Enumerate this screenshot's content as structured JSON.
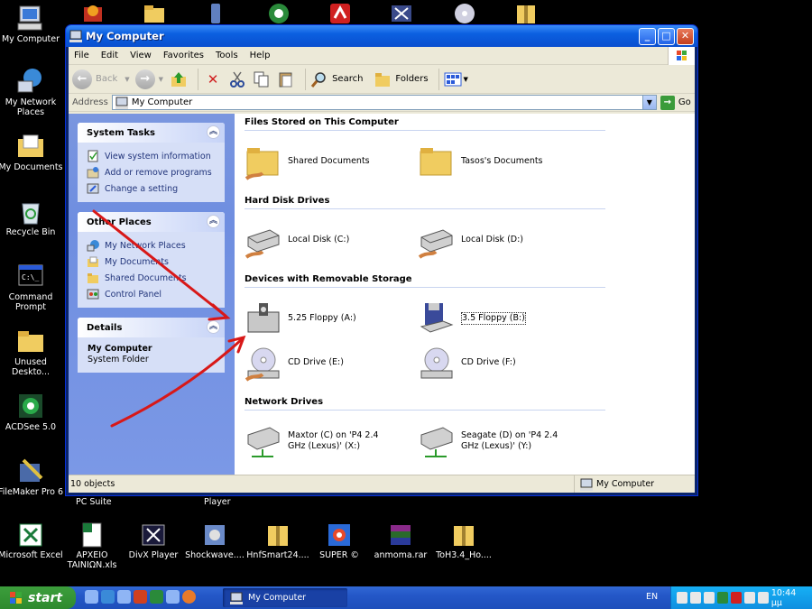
{
  "desktop_icons_left": [
    {
      "label": "My Computer",
      "icon": "my-computer-icon"
    },
    {
      "label": "My Network Places",
      "icon": "network-places-icon"
    },
    {
      "label": "My Documents",
      "icon": "my-documents-icon"
    },
    {
      "label": "Recycle Bin",
      "icon": "recycle-bin-icon"
    },
    {
      "label": "Command Prompt",
      "icon": "command-prompt-icon"
    },
    {
      "label": "Unused Deskto...",
      "icon": "folder-icon"
    },
    {
      "label": "ACDSee 5.0",
      "icon": "acdsee-icon"
    },
    {
      "label": "FileMaker Pro 6",
      "icon": "filemaker-icon"
    }
  ],
  "desktop_icons_bottom": [
    {
      "label": "Microsoft Excel",
      "icon": "excel-icon"
    },
    {
      "label": "APXEIO TAINIΩN.xls",
      "icon": "excel-file-icon"
    },
    {
      "label": "DivX Player",
      "icon": "divx-icon"
    },
    {
      "label": "Shockwave....",
      "icon": "shockwave-icon"
    },
    {
      "label": "HnfSmart24....",
      "icon": "zip-folder-icon"
    },
    {
      "label": "SUPER ©",
      "icon": "super-icon"
    },
    {
      "label": "anmoma.rar",
      "icon": "rar-icon"
    },
    {
      "label": "ToH3.4_Ho....",
      "icon": "zip-folder-icon"
    }
  ],
  "partial_labels": {
    "pc_suite": "PC Suite",
    "player": "Player"
  },
  "window": {
    "title": "My Computer",
    "menu": [
      "File",
      "Edit",
      "View",
      "Favorites",
      "Tools",
      "Help"
    ],
    "toolbar": {
      "back": "Back",
      "search": "Search",
      "folders": "Folders"
    },
    "address_label": "Address",
    "address_value": "My Computer",
    "go_label": "Go"
  },
  "left_pane": {
    "system_tasks": {
      "title": "System Tasks",
      "items": [
        "View system information",
        "Add or remove programs",
        "Change a setting"
      ]
    },
    "other_places": {
      "title": "Other Places",
      "items": [
        "My Network Places",
        "My Documents",
        "Shared Documents",
        "Control Panel"
      ]
    },
    "details": {
      "title": "Details",
      "name": "My Computer",
      "type": "System Folder"
    }
  },
  "sections": {
    "files": {
      "title": "Files Stored on This Computer",
      "items": [
        "Shared Documents",
        "Tasos's Documents"
      ]
    },
    "hdd": {
      "title": "Hard Disk Drives",
      "items": [
        "Local Disk (C:)",
        "Local Disk (D:)"
      ]
    },
    "removable": {
      "title": "Devices with Removable Storage",
      "items": [
        "5.25 Floppy (A:)",
        "3.5 Floppy (B:)",
        "CD Drive (E:)",
        "CD Drive (F:)"
      ]
    },
    "network": {
      "title": "Network Drives",
      "items": [
        "Maxtor (C) on 'P4 2.4 GHz (Lexus)' (X:)",
        "Seagate (D) on 'P4 2.4 GHz (Lexus)' (Y:)"
      ]
    }
  },
  "status": {
    "count": "10 objects",
    "location": "My Computer"
  },
  "taskbar": {
    "start": "start",
    "task": "My Computer",
    "lang": "EN",
    "clock": "10:44 μμ"
  },
  "colors": {
    "xp_blue": "#0b5fe0",
    "left_pane": "#7a96df",
    "annotation_red": "#d81818",
    "start_green": "#3c9e3c"
  }
}
